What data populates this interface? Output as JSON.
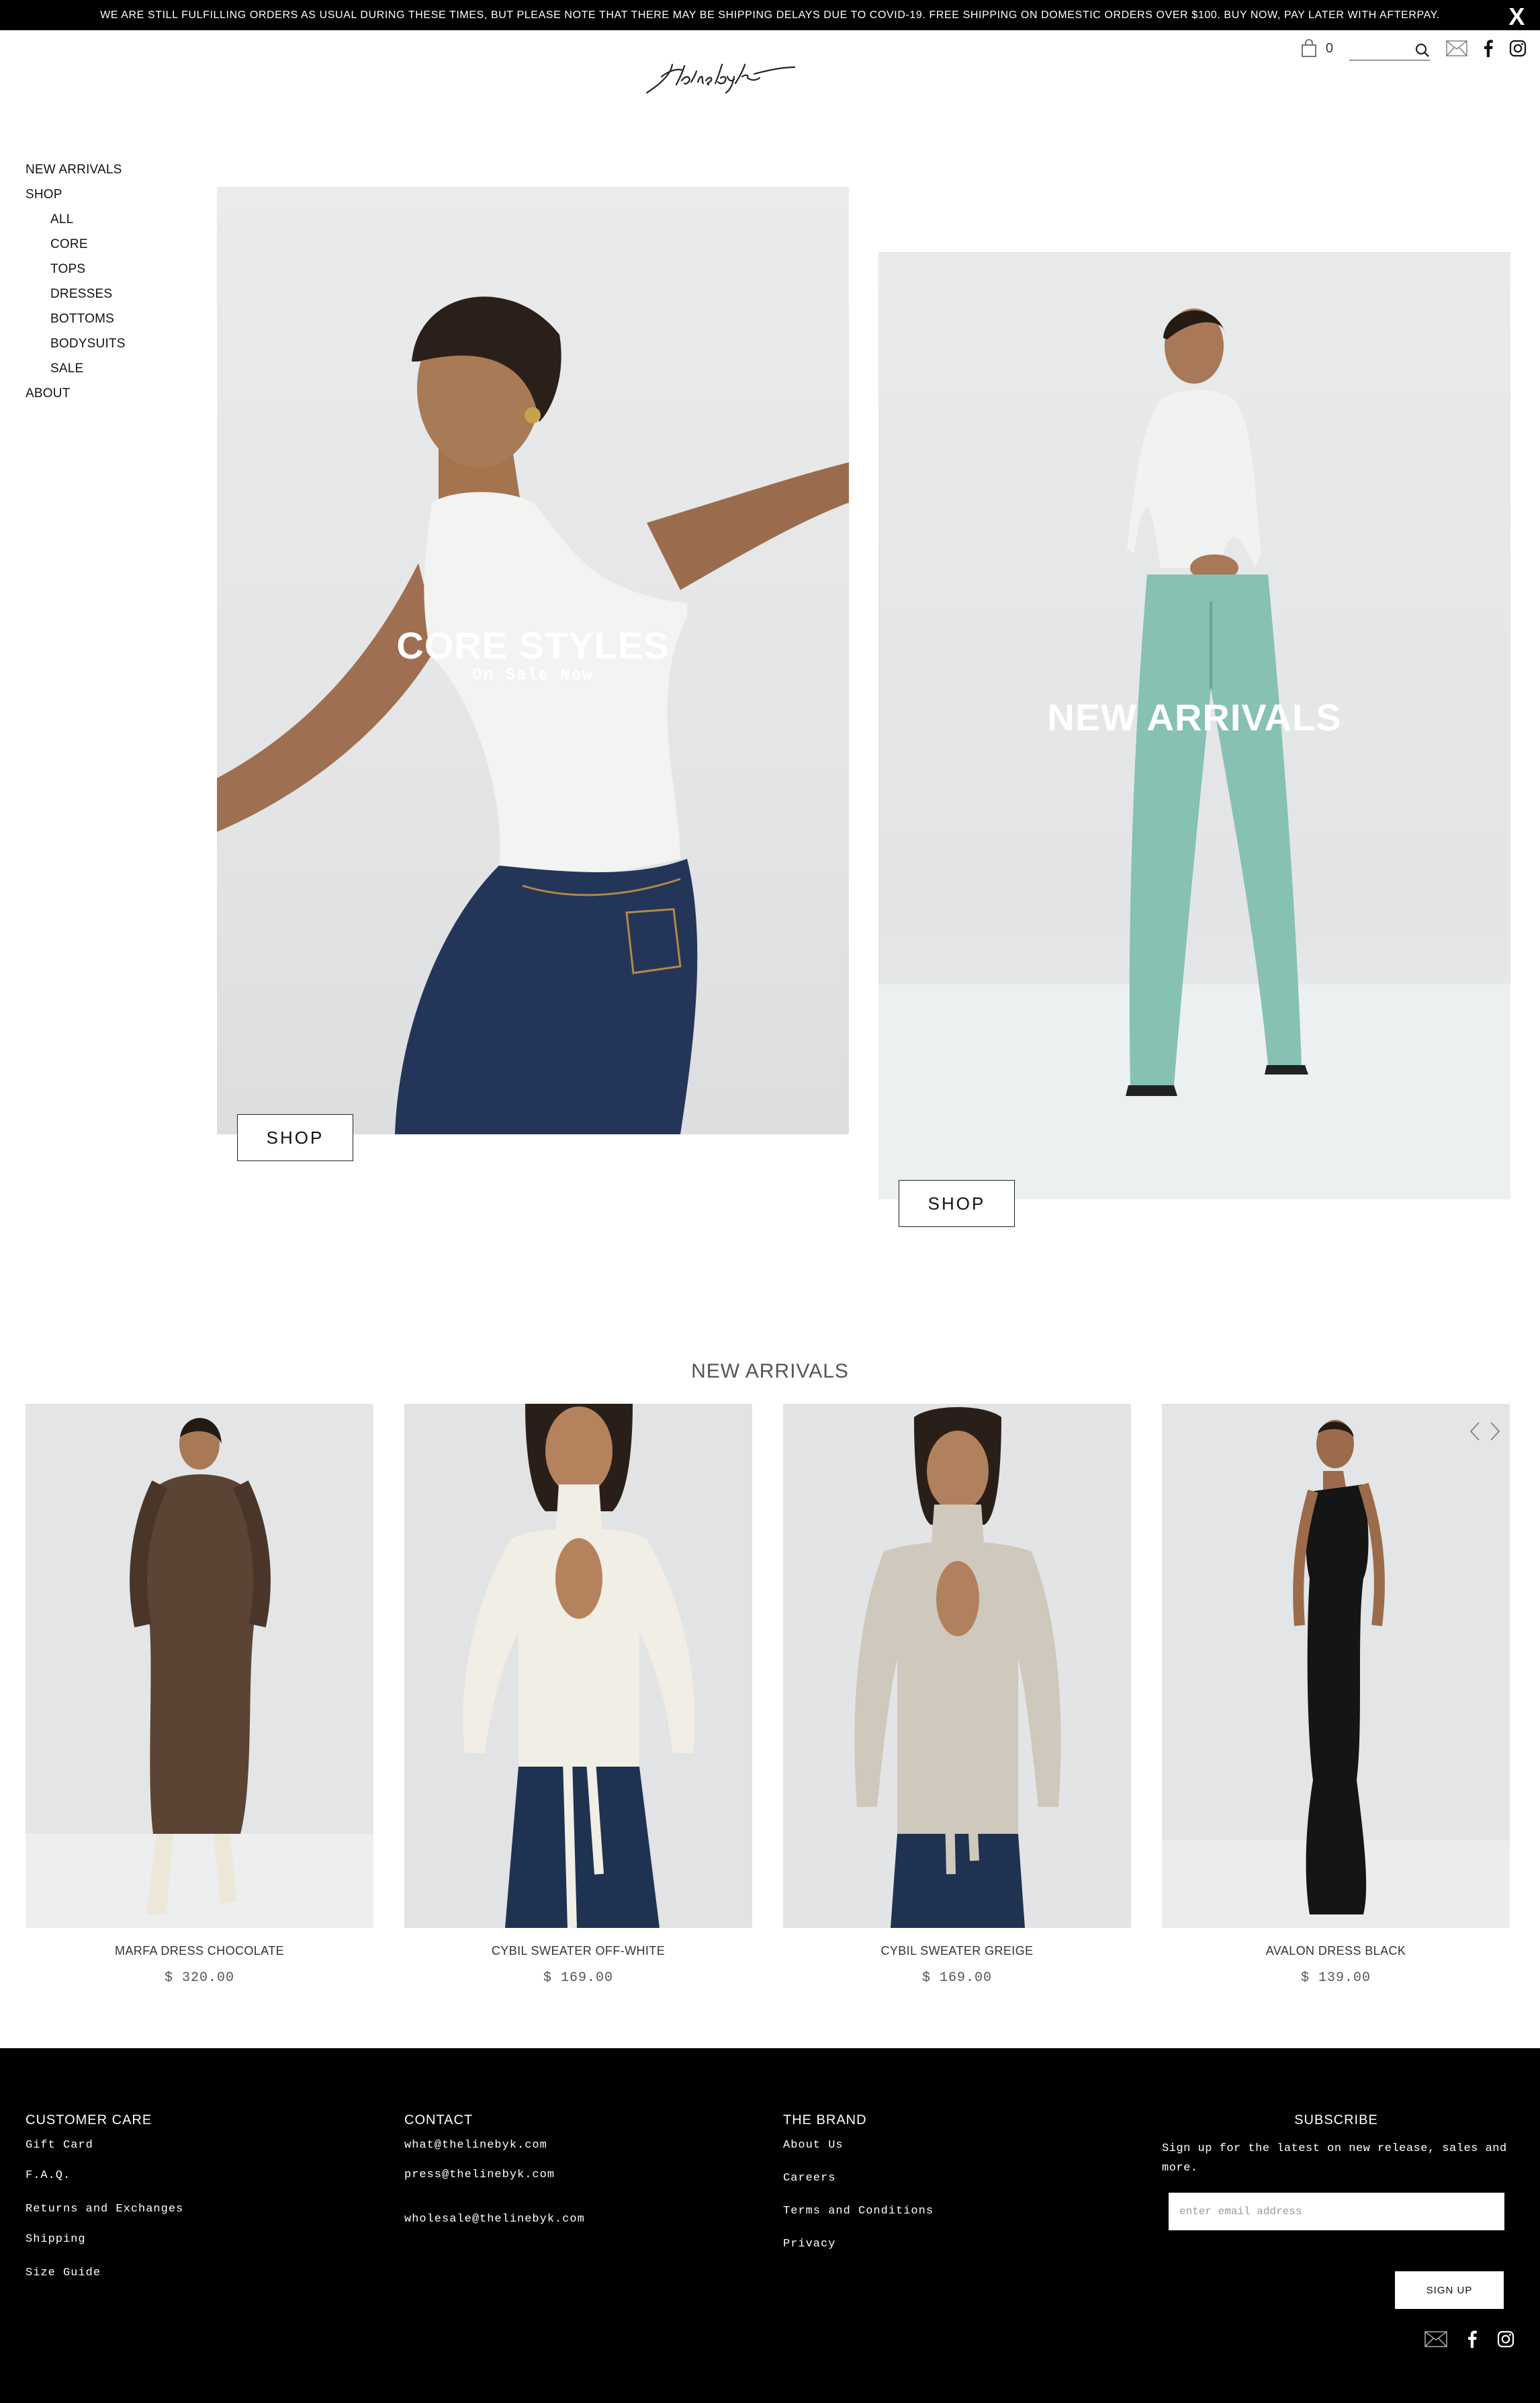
{
  "announcement": {
    "text": "WE ARE STILL FULFILLING ORDERS AS USUAL DURING THESE TIMES, BUT PLEASE NOTE THAT THERE MAY BE SHIPPING DELAYS DUE TO COVID-19. FREE SHIPPING ON DOMESTIC ORDERS OVER $100. BUY NOW, PAY LATER WITH AFTERPAY.",
    "close_label": "X"
  },
  "header": {
    "logo_icon": "thelinebyk-script-logo",
    "cart_count": "0",
    "search_placeholder": ""
  },
  "nav": {
    "new_arrivals": "NEW ARRIVALS",
    "shop": "SHOP",
    "shop_items": [
      "ALL",
      "CORE",
      "TOPS",
      "DRESSES",
      "BOTTOMS",
      "BODYSUITS",
      "SALE"
    ],
    "about": "ABOUT"
  },
  "hero": {
    "left": {
      "title": "CORE STYLES",
      "subtitle": "On Sale Now",
      "button": "SHOP"
    },
    "right": {
      "title": "NEW ARRIVALS",
      "button": "SHOP"
    }
  },
  "new_arrivals": {
    "title": "NEW ARRIVALS",
    "products": [
      {
        "name": "MARFA DRESS CHOCOLATE",
        "price": "$ 320.00",
        "color": "#5b4434"
      },
      {
        "name": "CYBIL SWEATER OFF-WHITE",
        "price": "$ 169.00",
        "color": "#f1eee6"
      },
      {
        "name": "CYBIL SWEATER GREIGE",
        "price": "$ 169.00",
        "color": "#cfc8bd"
      },
      {
        "name": "AVALON DRESS BLACK",
        "price": "$ 139.00",
        "color": "#151515"
      }
    ]
  },
  "footer": {
    "customer_care": {
      "title": "CUSTOMER CARE",
      "links": [
        "Gift Card",
        "F.A.Q.",
        "Returns and Exchanges",
        "Shipping",
        "Size Guide"
      ]
    },
    "contact": {
      "title": "CONTACT",
      "links": [
        "what@thelinebyk.com",
        "press@thelinebyk.com",
        "wholesale@thelinebyk.com"
      ]
    },
    "brand": {
      "title": "THE BRAND",
      "links": [
        "About Us",
        "Careers",
        "Terms and Conditions",
        "Privacy"
      ]
    },
    "subscribe": {
      "title": "SUBSCRIBE",
      "text": "Sign up for the latest on new release, sales and more.",
      "placeholder": "enter email address",
      "button": "SIGN UP"
    }
  }
}
